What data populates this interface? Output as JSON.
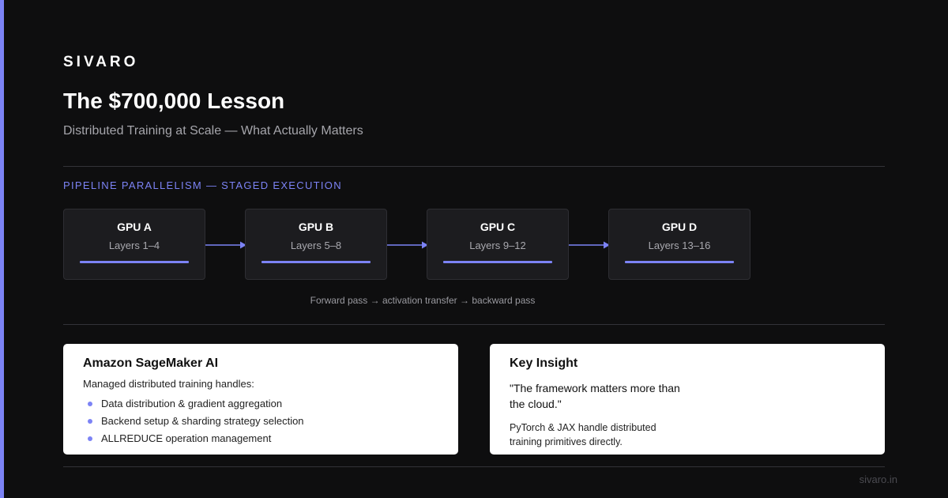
{
  "brand": "SIVARO",
  "title": "The $700,000 Lesson",
  "subtitle": "Distributed Training at Scale — What Actually Matters",
  "section_label": "PIPELINE PARALLELISM — STAGED EXECUTION",
  "gpus": [
    {
      "name": "GPU A",
      "layers": "Layers 1–4"
    },
    {
      "name": "GPU B",
      "layers": "Layers 5–8"
    },
    {
      "name": "GPU C",
      "layers": "Layers 9–12"
    },
    {
      "name": "GPU D",
      "layers": "Layers 13–16"
    }
  ],
  "caption": "Forward pass → activation transfer → backward pass",
  "sagemaker_card": {
    "title": "Amazon SageMaker AI",
    "intro": "Managed distributed training handles:",
    "bullets": [
      "Data distribution & gradient aggregation",
      "Backend setup & sharding strategy selection",
      "ALLREDUCE operation management"
    ]
  },
  "insight_card": {
    "title": "Key Insight",
    "quote": "\"The framework matters more than the cloud.\"",
    "note": "PyTorch & JAX handle distributed training primitives directly."
  },
  "footer_url": "sivaro.in",
  "colors": {
    "accent": "#7c83f5",
    "background": "#0e0e0f",
    "card": "#ffffff"
  }
}
